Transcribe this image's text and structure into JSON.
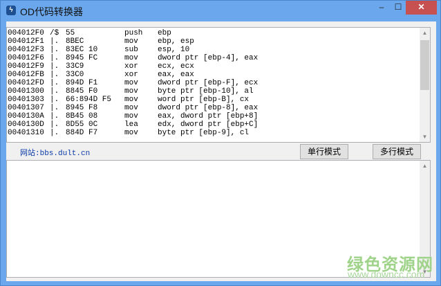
{
  "window": {
    "title": "OD代码转换器",
    "minimize": "‒",
    "maximize": "☐",
    "close": "✕"
  },
  "code_lines": [
    [
      "004012F0",
      "/$",
      "55",
      "push",
      "ebp"
    ],
    [
      "004012F1",
      "|.",
      "8BEC",
      "mov",
      "ebp, esp"
    ],
    [
      "004012F3",
      "|.",
      "83EC 10",
      "sub",
      "esp, 10"
    ],
    [
      "004012F6",
      "|.",
      "8945 FC",
      "mov",
      "dword ptr [ebp-4], eax"
    ],
    [
      "004012F9",
      "|.",
      "33C9",
      "xor",
      "ecx, ecx"
    ],
    [
      "004012FB",
      "|.",
      "33C0",
      "xor",
      "eax, eax"
    ],
    [
      "004012FD",
      "|.",
      "894D F1",
      "mov",
      "dword ptr [ebp-F], ecx"
    ],
    [
      "00401300",
      "|.",
      "8845 F0",
      "mov",
      "byte ptr [ebp-10], al"
    ],
    [
      "00401303",
      "|.",
      "66:894D F5",
      "mov",
      "word ptr [ebp-B], cx"
    ],
    [
      "00401307",
      "|.",
      "8945 F8",
      "mov",
      "dword ptr [ebp-8], eax"
    ],
    [
      "0040130A",
      "|.",
      "8B45 08",
      "mov",
      "eax, dword ptr [ebp+8]"
    ],
    [
      "0040130D",
      "|.",
      "8D55 0C",
      "lea",
      "edx, dword ptr [ebp+C]"
    ],
    [
      "00401310",
      "|.",
      "884D F7",
      "mov",
      "byte ptr [ebp-9], cl"
    ]
  ],
  "website": "网站:bbs.dult.cn",
  "buttons": {
    "single": "单行模式",
    "multi": "多行模式"
  },
  "watermark": {
    "name": "绿色资源网",
    "url": "www.downcc.com"
  }
}
